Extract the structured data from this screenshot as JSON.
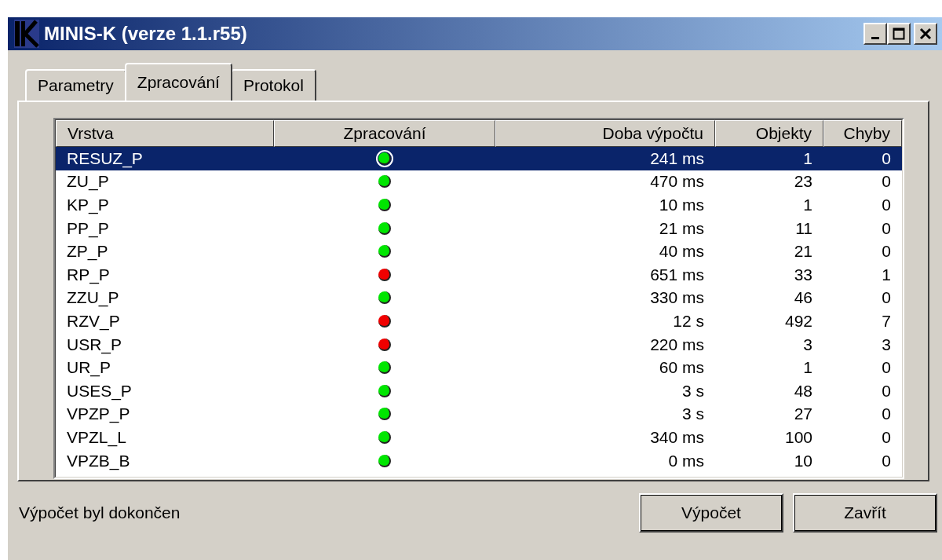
{
  "window": {
    "title": "MINIS-K (verze 1.1.r55)"
  },
  "tabs": [
    {
      "label": "Parametry",
      "selected": false
    },
    {
      "label": "Zpracování",
      "selected": true
    },
    {
      "label": "Protokol",
      "selected": false
    }
  ],
  "table": {
    "columns": [
      "Vrstva",
      "Zpracování",
      "Doba výpočtu",
      "Objekty",
      "Chyby"
    ],
    "rows": [
      {
        "layer": "RESUZ_P",
        "color": "#00e600",
        "time": "241 ms",
        "objects": "1",
        "errors": "0",
        "selected": true
      },
      {
        "layer": "ZU_P",
        "color": "#00e600",
        "time": "470 ms",
        "objects": "23",
        "errors": "0",
        "selected": false
      },
      {
        "layer": "KP_P",
        "color": "#00e600",
        "time": "10 ms",
        "objects": "1",
        "errors": "0",
        "selected": false
      },
      {
        "layer": "PP_P",
        "color": "#00e600",
        "time": "21 ms",
        "objects": "11",
        "errors": "0",
        "selected": false
      },
      {
        "layer": "ZP_P",
        "color": "#00e600",
        "time": "40 ms",
        "objects": "21",
        "errors": "0",
        "selected": false
      },
      {
        "layer": "RP_P",
        "color": "#f00000",
        "time": "651 ms",
        "objects": "33",
        "errors": "1",
        "selected": false
      },
      {
        "layer": "ZZU_P",
        "color": "#00e600",
        "time": "330 ms",
        "objects": "46",
        "errors": "0",
        "selected": false
      },
      {
        "layer": "RZV_P",
        "color": "#f00000",
        "time": "12 s",
        "objects": "492",
        "errors": "7",
        "selected": false
      },
      {
        "layer": "USR_P",
        "color": "#f00000",
        "time": "220 ms",
        "objects": "3",
        "errors": "3",
        "selected": false
      },
      {
        "layer": "UR_P",
        "color": "#00e600",
        "time": "60 ms",
        "objects": "1",
        "errors": "0",
        "selected": false
      },
      {
        "layer": "USES_P",
        "color": "#00e600",
        "time": "3 s",
        "objects": "48",
        "errors": "0",
        "selected": false
      },
      {
        "layer": "VPZP_P",
        "color": "#00e600",
        "time": "3 s",
        "objects": "27",
        "errors": "0",
        "selected": false
      },
      {
        "layer": "VPZL_L",
        "color": "#00e600",
        "time": "340 ms",
        "objects": "100",
        "errors": "0",
        "selected": false
      },
      {
        "layer": "VPZB_B",
        "color": "#00e600",
        "time": "0 ms",
        "objects": "10",
        "errors": "0",
        "selected": false
      }
    ]
  },
  "status_bar": {
    "text": "Výpočet byl dokončen"
  },
  "buttons": [
    "Výpočet",
    "Zavřít"
  ]
}
